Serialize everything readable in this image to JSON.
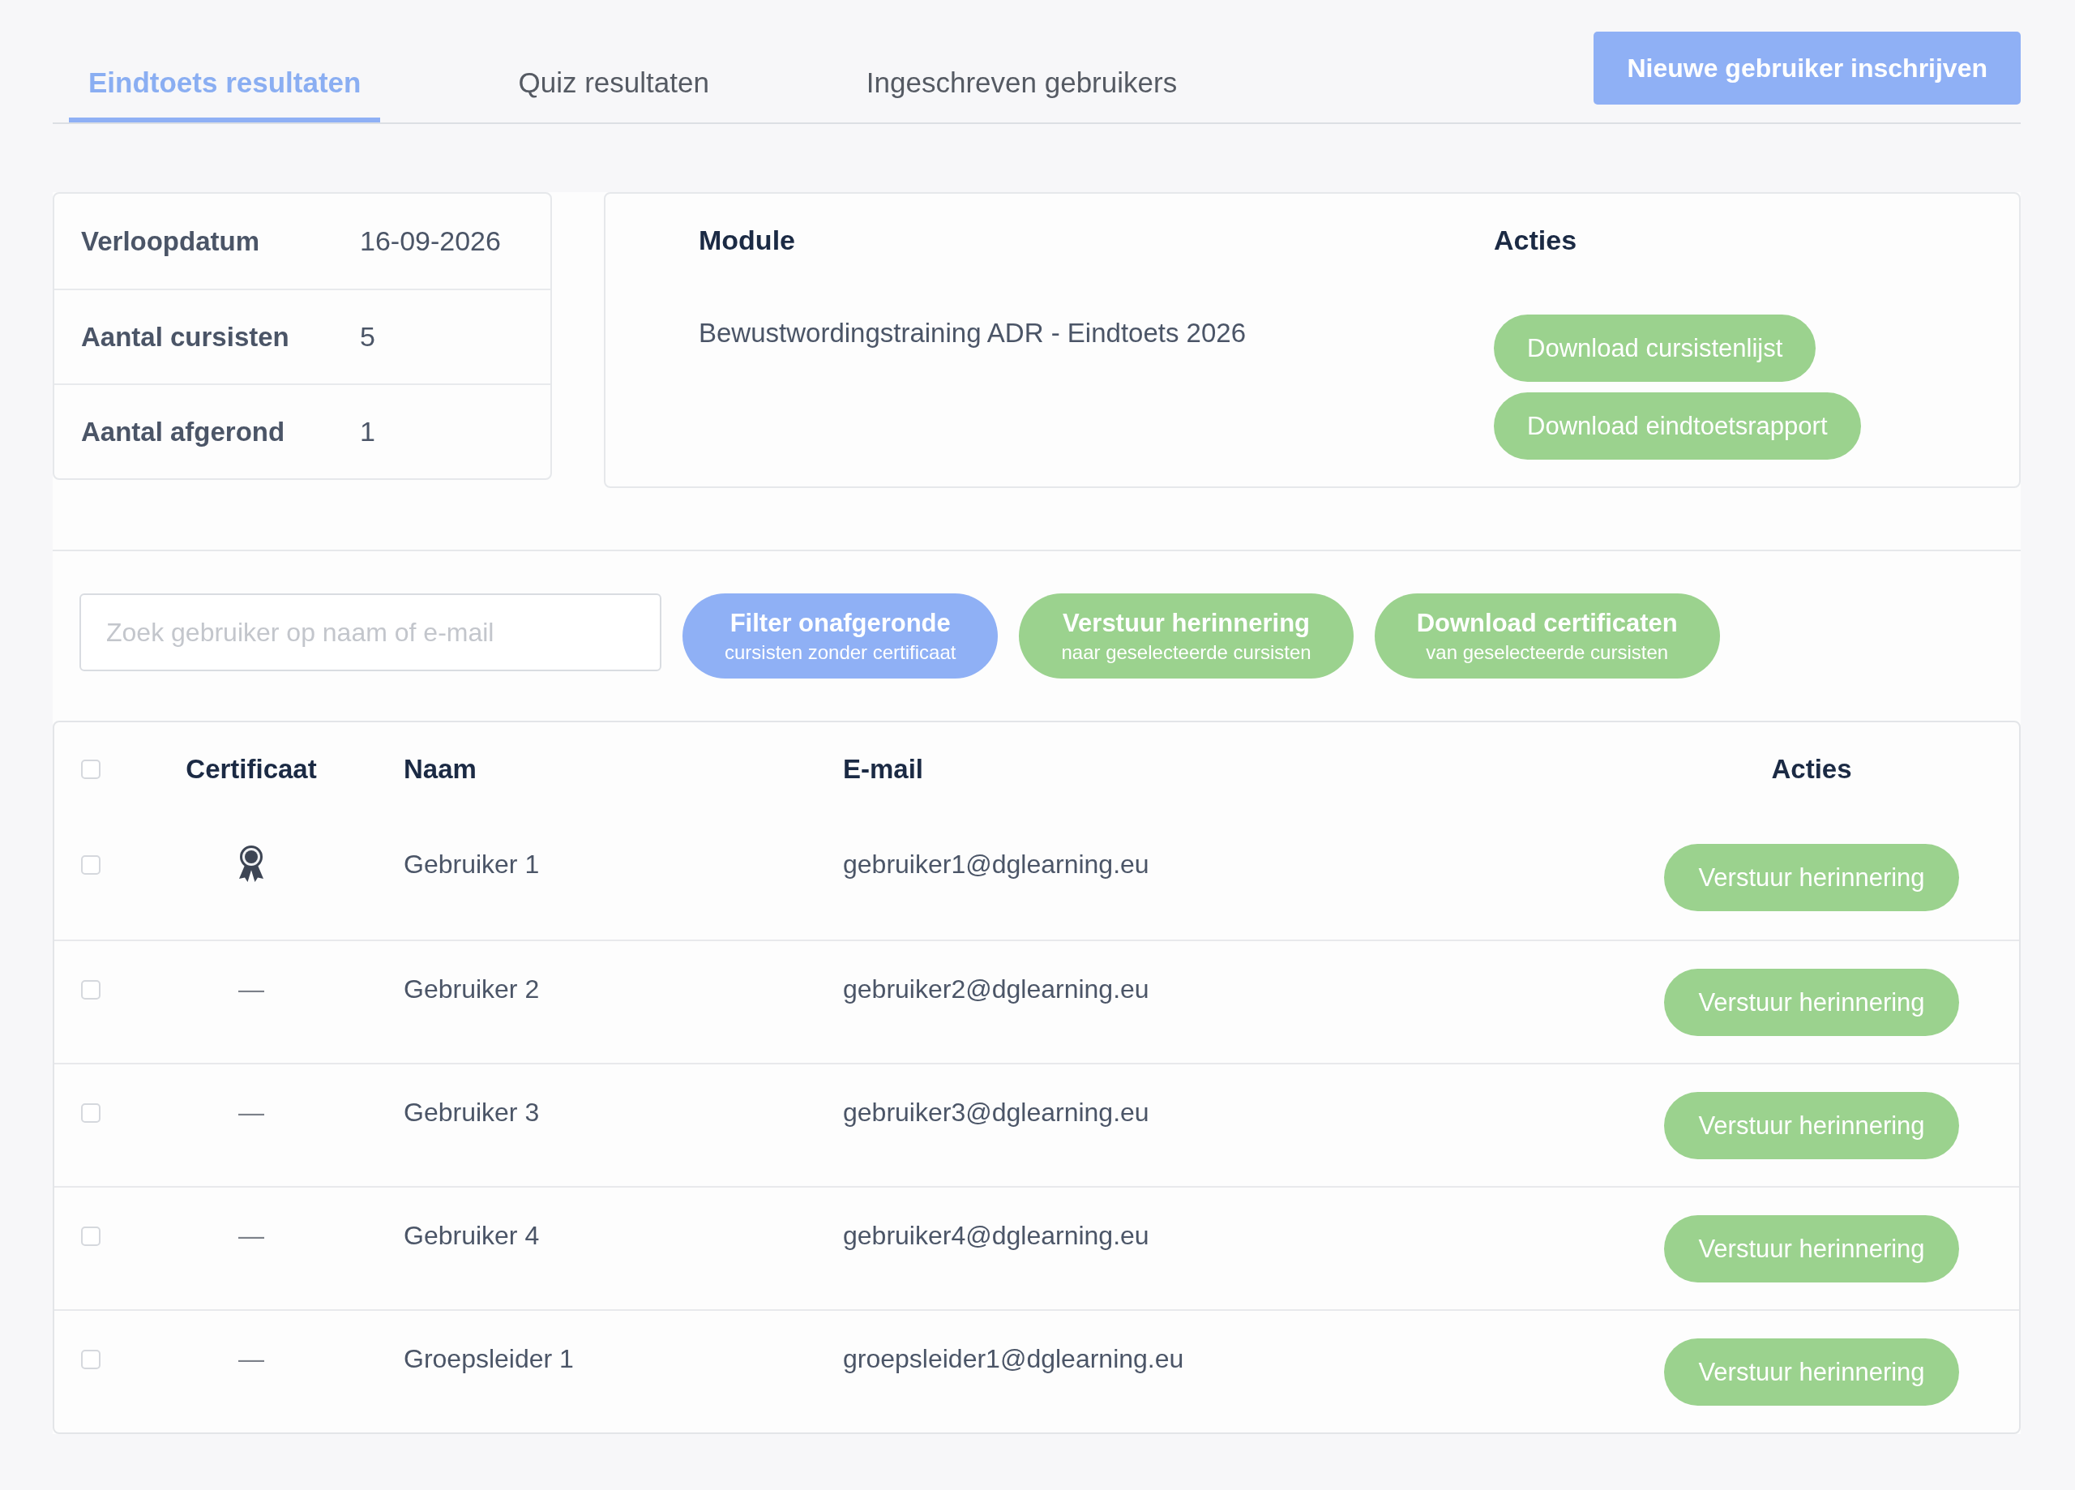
{
  "tabs": [
    {
      "label": "Eindtoets resultaten",
      "selected": true
    },
    {
      "label": "Quiz resultaten",
      "selected": false
    },
    {
      "label": "Ingeschreven gebruikers",
      "selected": false
    }
  ],
  "enroll_button": {
    "label": "Nieuwe gebruiker inschrijven"
  },
  "summary": [
    {
      "label": "Verloopdatum",
      "value": "16-09-2026"
    },
    {
      "label": "Aantal cursisten",
      "value": "5"
    },
    {
      "label": "Aantal afgerond",
      "value": "1"
    }
  ],
  "module_card": {
    "headers": [
      "Module",
      "Acties"
    ],
    "module": "Bewustwordingstraining ADR - Eindtoets 2026",
    "actions": [
      "Download cursistenlijst",
      "Download eindtoetsrapport"
    ]
  },
  "toolbar": {
    "search": {
      "placeholder": "Zoek gebruiker op naam of e-mail"
    },
    "buttons": [
      {
        "kind": "filter",
        "label": "Filter onafgeronde",
        "sublabel": "cursisten zonder certificaat"
      },
      {
        "kind": "action",
        "label": "Verstuur herinnering",
        "sublabel": "naar geselecteerde cursisten"
      },
      {
        "kind": "action",
        "label": "Download certificaten",
        "sublabel": "van geselecteerde cursisten"
      }
    ]
  },
  "table": {
    "select_all_checked": false,
    "columns": [
      "Certificaat",
      "Naam",
      "E-mail",
      "Acties"
    ],
    "rows": [
      {
        "checked": false,
        "certified": true,
        "name": "Gebruiker 1",
        "email": "gebruiker1@dglearning.eu",
        "action": "Verstuur herinnering"
      },
      {
        "checked": false,
        "certified": false,
        "certificate_text": "—",
        "name": "Gebruiker 2",
        "email": "gebruiker2@dglearning.eu",
        "action": "Verstuur herinnering"
      },
      {
        "checked": false,
        "certified": false,
        "certificate_text": "—",
        "name": "Gebruiker 3",
        "email": "gebruiker3@dglearning.eu",
        "action": "Verstuur herinnering"
      },
      {
        "checked": false,
        "certified": false,
        "certificate_text": "—",
        "name": "Gebruiker 4",
        "email": "gebruiker4@dglearning.eu",
        "action": "Verstuur herinnering"
      },
      {
        "checked": false,
        "certified": false,
        "certificate_text": "—",
        "name": "Groepsleider 1",
        "email": "groepsleider1@dglearning.eu",
        "action": "Verstuur herinnering"
      }
    ]
  }
}
